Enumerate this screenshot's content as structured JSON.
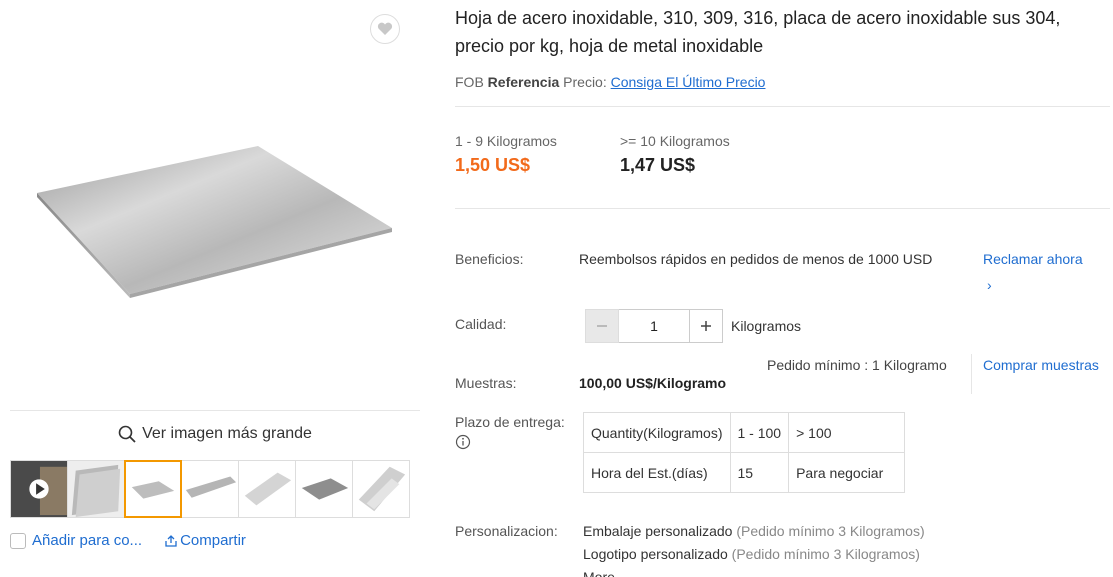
{
  "gallery": {
    "enlarge_label": "Ver imagen más grande",
    "add_compare_label": "Añadir para co...",
    "share_label": "Compartir"
  },
  "product": {
    "title": "Hoja de acero inoxidable, 310, 309, 316, placa de acero inoxidable sus 304, precio por kg, hoja de metal inoxidable",
    "fob_prefix": "FOB",
    "fob_bold": "Referencia",
    "fob_mid": "Precio:",
    "fob_link": "Consiga El Último Precio"
  },
  "tiers": [
    {
      "range": "1 - 9 Kilogramos",
      "price": "1,50 US$"
    },
    {
      "range": ">= 10 Kilogramos",
      "price": "1,47 US$"
    }
  ],
  "benefits": {
    "label": "Beneficios:",
    "text": "Reembolsos rápidos en pedidos de menos de 1000 USD",
    "claim": "Reclamar ahora",
    "claim_arrow": "›"
  },
  "quantity": {
    "label": "Calidad:",
    "value": "1",
    "unit": "Kilogramos"
  },
  "samples": {
    "label": "Muestras:",
    "price": "100,00 US$/Kilogramo",
    "min_order": "Pedido mínimo : 1 Kilogramo",
    "buy": "Comprar muestras"
  },
  "lead_time": {
    "label": "Plazo de entrega:",
    "rows": [
      [
        "Quantity(Kilogramos)",
        "1 - 100",
        "> 100"
      ],
      [
        "Hora del Est.(días)",
        "15",
        "Para negociar"
      ]
    ]
  },
  "customization": {
    "label": "Personalizacion:",
    "items": [
      {
        "name": "Embalaje personalizado",
        "note": "(Pedido mínimo 3 Kilogramos)"
      },
      {
        "name": "Logotipo personalizado",
        "note": "(Pedido mínimo 3 Kilogramos)"
      }
    ],
    "more": "More"
  },
  "colors": {
    "accent_price": "#f26a1b",
    "link": "#1f6dd0",
    "active_thumb": "#f39800"
  }
}
